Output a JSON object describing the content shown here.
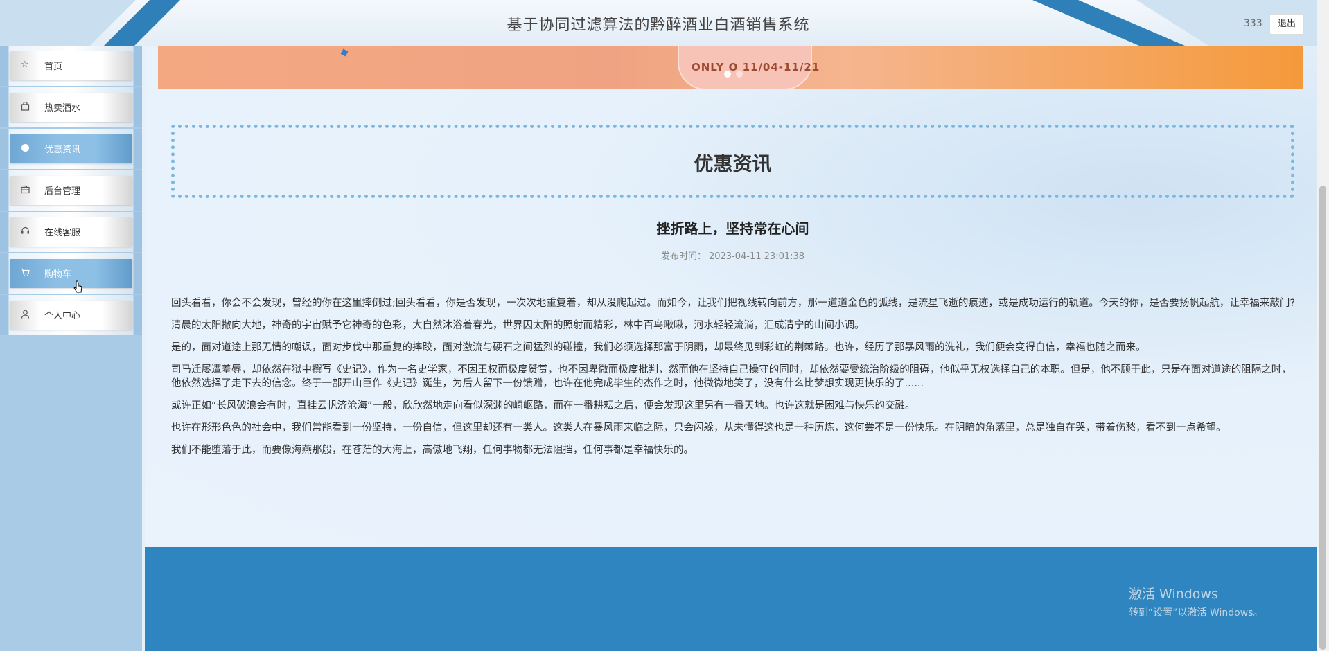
{
  "header": {
    "title": "基于协同过滤算法的黔醉酒业白酒销售系统",
    "username": "333",
    "logout_label": "退出"
  },
  "sidebar": {
    "items": [
      {
        "label": "首页",
        "icon": "star-icon",
        "active": false
      },
      {
        "label": "热卖酒水",
        "icon": "shopping-bag-icon",
        "active": false
      },
      {
        "label": "优惠资讯",
        "icon": "circle-icon",
        "active": true
      },
      {
        "label": "后台管理",
        "icon": "briefcase-icon",
        "active": false
      },
      {
        "label": "在线客服",
        "icon": "headset-icon",
        "active": false
      },
      {
        "label": "购物车",
        "icon": "cart-icon",
        "active": true
      },
      {
        "label": "个人中心",
        "icon": "user-icon",
        "active": false
      }
    ]
  },
  "banner": {
    "text": "ONLY O 11/04-11/21"
  },
  "main": {
    "section_title": "优惠资讯",
    "article_title": "挫折路上，坚持常在心间",
    "publish_label": "发布时间：",
    "publish_time": "2023-04-11 23:01:38",
    "paragraphs": [
      "回头看看，你会不会发现，曾经的你在这里摔倒过;回头看看，你是否发现，一次次地重复着，却从没爬起过。而如今，让我们把视线转向前方，那一道道金色的弧线，是流星飞逝的痕迹，或是成功运行的轨道。今天的你，是否要扬帆起航，让幸福来敲门?",
      "清晨的太阳撒向大地，神奇的宇宙赋予它神奇的色彩，大自然沐浴着春光，世界因太阳的照射而精彩，林中百鸟啾啾，河水轻轻流淌，汇成清宁的山间小调。",
      "是的，面对道途上那无情的嘲讽，面对步伐中那重复的摔跤，面对激流与硬石之间猛烈的碰撞，我们必须选择那富于阴雨，却最终见到彩虹的荆棘路。也许，经历了那暴风雨的洗礼，我们便会变得自信，幸福也随之而来。",
      "司马迁屡遭羞辱，却依然在狱中撰写《史记》，作为一名史学家，不因王权而极度赞赏，也不因卑微而极度批判，然而他在坚持自己操守的同时，却依然要受统治阶级的阻碍，他似乎无权选择自己的本职。但是，他不顾于此，只是在面对道途的阻隔之时，他依然选择了走下去的信念。终于一部开山巨作《史记》诞生，为后人留下一份馈赠，也许在他完成毕生的杰作之时，他微微地笑了，没有什么比梦想实现更快乐的了......",
      "或许正如“长风破浪会有时，直挂云帆济沧海”一般，欣欣然地走向看似深渊的崎岖路，而在一番耕耘之后，便会发现这里另有一番天地。也许这就是困难与快乐的交融。",
      "也许在形形色色的社会中，我们常能看到一份坚持，一份自信，但这里却还有一类人。这类人在暴风雨来临之际，只会闪躲，从未懂得这也是一种历炼，这何尝不是一份快乐。在阴暗的角落里，总是独自在哭，带着伤愁，看不到一点希望。",
      "我们不能堕落于此，而要像海燕那般，在苍茫的大海上，高傲地飞翔，任何事物都无法阻挡，任何事都是幸福快乐的。"
    ]
  },
  "watermark": {
    "line1": "激活 Windows",
    "line2": "转到“设置”以激活 Windows。"
  },
  "colors": {
    "accent": "#2f85c0",
    "sidebar_bg": "#a9cbe6",
    "active_item": "#8ec0e6",
    "section_border": "#7ab8df"
  }
}
